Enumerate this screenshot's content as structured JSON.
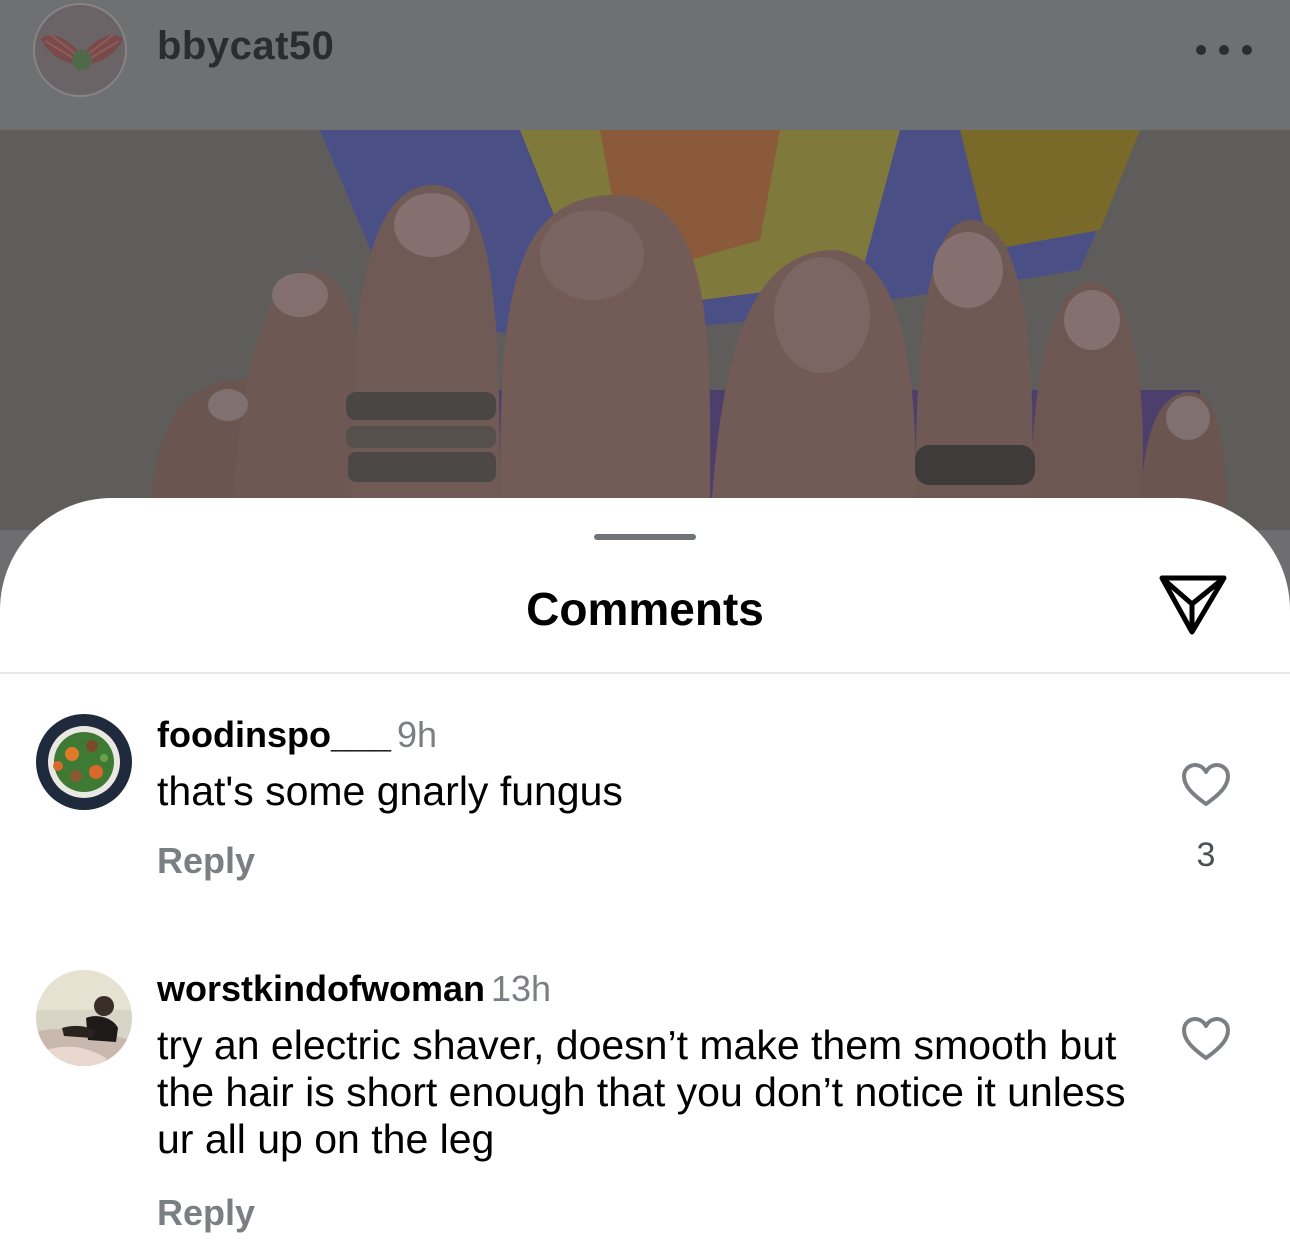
{
  "post": {
    "username": "bbycat50",
    "avatar_icon": "profile-avatar-icon",
    "more_icon": "more-options-icon",
    "image_icon": "post-photo"
  },
  "sheet": {
    "title": "Comments",
    "share_icon": "send-icon"
  },
  "comments": [
    {
      "username": "foodinspo___",
      "time": "9h",
      "text": "that's some gnarly fungus",
      "reply_label": "Reply",
      "like_count": "3",
      "like_icon": "heart-icon"
    },
    {
      "username": "worstkindofwoman",
      "time": "13h",
      "text": "try an electric shaver, doesn’t make them smooth but the hair is short enough that you don’t notice it unless ur all up on the leg",
      "reply_label": "Reply",
      "like_icon": "heart-icon"
    }
  ]
}
